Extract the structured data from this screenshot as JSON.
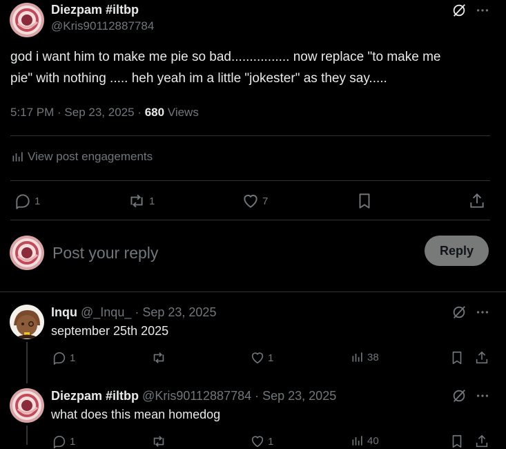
{
  "post": {
    "display_name": "Diezpam #iltbp",
    "handle": "@Kris90112887784",
    "text_line1": "god i want him to make me pie so bad................ now replace \"to make me",
    "text_line2": "pie\" with nothing ..... heh yeah im a little \"jokester\" as they say.....",
    "time": "5:17 PM · Sep 23, 2025 ·",
    "views_count": "680",
    "views_label": "Views",
    "engagements_label": "View post engagements",
    "reply_count": "1",
    "repost_count": "1",
    "like_count": "7"
  },
  "composer": {
    "placeholder": "Post your reply",
    "reply_button": "Reply"
  },
  "replies": [
    {
      "display_name": "Inqu",
      "handle": "@_Inqu_",
      "date": "· Sep 23, 2025",
      "text": "september 25th 2025",
      "reply_count": "1",
      "repost_count": "",
      "like_count": "1",
      "views_count": "38"
    },
    {
      "display_name": "Diezpam #iltbp",
      "handle": "@Kris90112887784",
      "date": "· Sep 23, 2025",
      "text": "what does this mean homedog",
      "reply_count": "1",
      "repost_count": "",
      "like_count": "1",
      "views_count": "40"
    }
  ],
  "icons": [
    "grok-icon",
    "more-icon",
    "analytics-icon",
    "reply-icon",
    "repost-icon",
    "like-icon",
    "bookmark-icon",
    "share-icon"
  ],
  "colors": {
    "background": "#000000",
    "text": "#e7e9ea",
    "muted": "#71767b",
    "divider": "#2f3336",
    "reply_button_bg": "#787a7a"
  }
}
